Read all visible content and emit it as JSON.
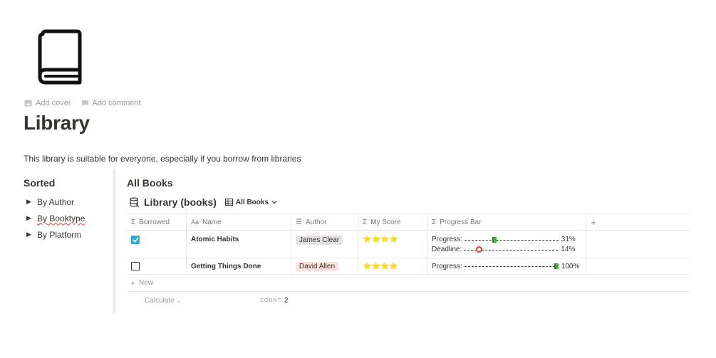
{
  "page": {
    "icon": "book-icon",
    "add_cover": "Add cover",
    "add_comment": "Add comment",
    "title": "Library",
    "description": "This library is suitable for everyone, especially if you borrow from libraries"
  },
  "sidebar": {
    "heading": "Sorted",
    "items": [
      {
        "label": "By Author"
      },
      {
        "label": "By Booktype"
      },
      {
        "label": "By Platform"
      }
    ]
  },
  "section": {
    "title": "All Books"
  },
  "database": {
    "title": "Library (books)",
    "view": "All Books",
    "columns": [
      {
        "label": "Borrowed",
        "icon": "sigma-icon"
      },
      {
        "label": "Name",
        "icon": "text-icon"
      },
      {
        "label": "Author",
        "icon": "list-icon"
      },
      {
        "label": "My Score",
        "icon": "sigma-icon"
      },
      {
        "label": "Progress Bar",
        "icon": "sigma-icon"
      }
    ],
    "add_column": "+",
    "rows": [
      {
        "borrowed": true,
        "name": "Atomic Habits",
        "author": "James Clear",
        "score": "⭐⭐⭐⭐",
        "progress_label": "Progress:",
        "progress_value": "31%",
        "progress_fraction": 0.31,
        "deadline_label": "Deadline:",
        "deadline_value": "14%",
        "deadline_fraction": 0.14
      },
      {
        "borrowed": false,
        "name": "Getting Things Done",
        "author": "David Allen",
        "score": "⭐⭐⭐⭐",
        "progress_label": "Progress:",
        "progress_value": "100%",
        "progress_fraction": 1.0
      }
    ],
    "new_label": "New",
    "calculate_label": "Calculate",
    "count_label": "COUNT",
    "count_value": "2"
  },
  "colors": {
    "checkbox_checked": "#2eaadc",
    "tag_gray": "#e3e2e0",
    "tag_red": "#ffe2dd",
    "progress_marker": "#4caf50",
    "deadline_marker": "#e03e3e"
  }
}
